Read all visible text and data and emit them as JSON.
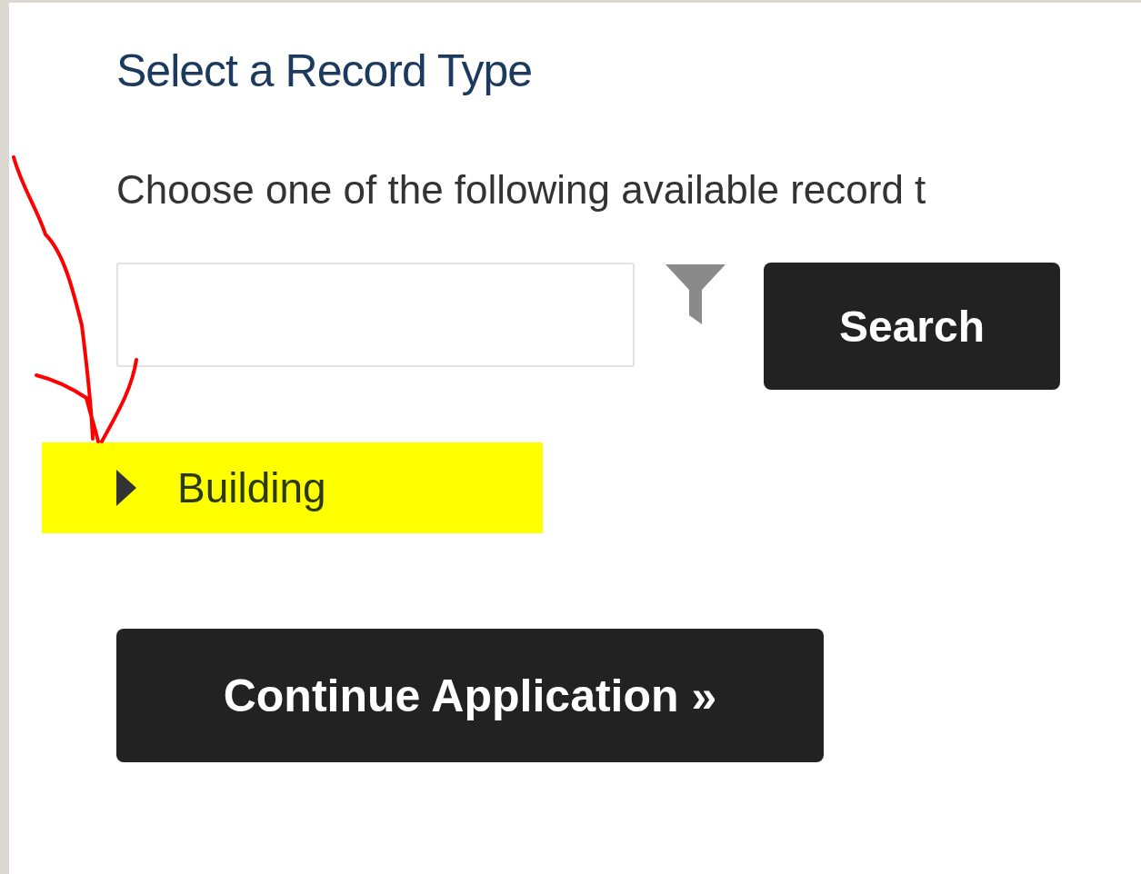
{
  "title": "Select a Record Type",
  "instructions": "Choose one of the following available record t",
  "search": {
    "button": "Search"
  },
  "record_types": [
    {
      "label": "Building",
      "expanded": false,
      "highlighted": true
    }
  ],
  "continue_button": "Continue Application »"
}
